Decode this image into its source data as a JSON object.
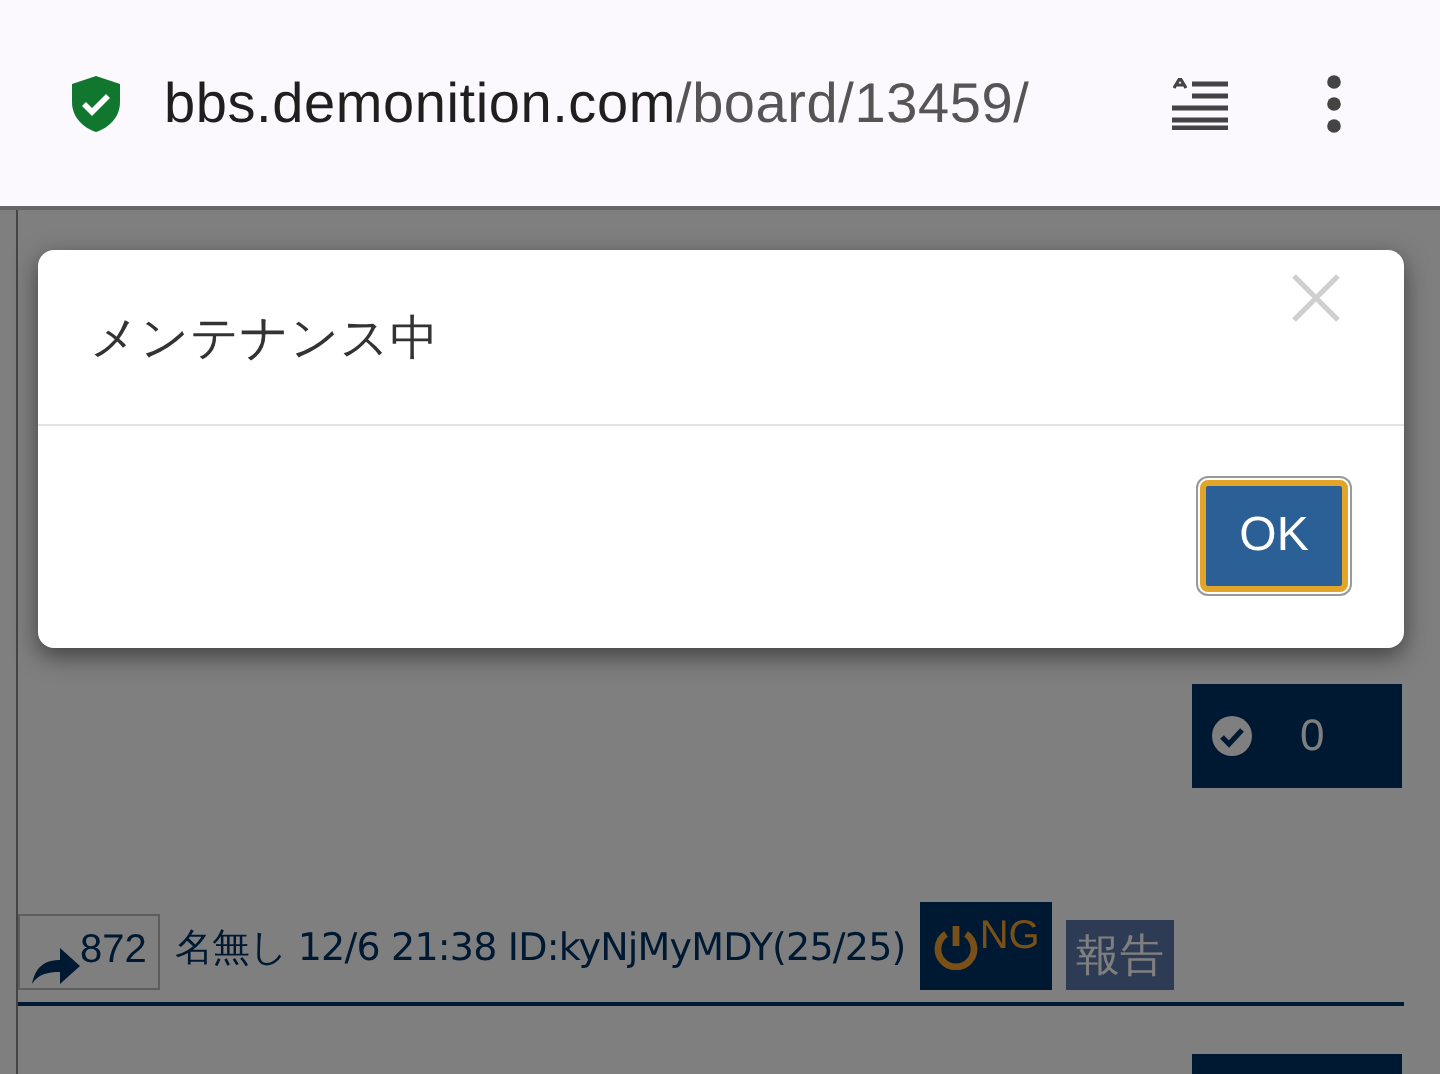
{
  "browser": {
    "url_host": "bbs.demonition.com",
    "url_path": "/board/13459/",
    "secure": true
  },
  "post": {
    "like_count": "0"
  },
  "post_footer": {
    "reply_count": "872",
    "author": "名無し",
    "date": "12/6 21:38",
    "id": "ID:kyNjMyMDY(25/25)",
    "ng_label": "NG",
    "report_label": "報告"
  },
  "modal": {
    "title": "メンテナンス中",
    "ok": "OK"
  }
}
